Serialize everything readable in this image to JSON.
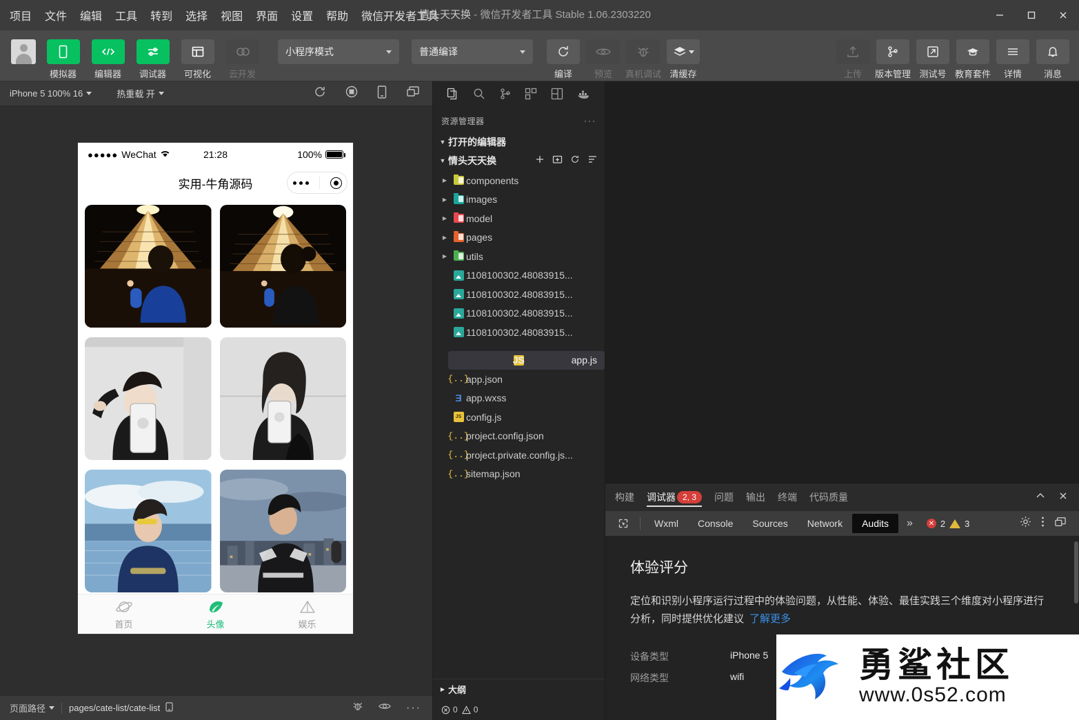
{
  "window": {
    "title_project": "情头天天换",
    "title_sep": " - ",
    "title_app": "微信开发者工具 Stable 1.06.2303220",
    "minimize": "minimize-icon",
    "maximize": "maximize-icon",
    "close": "close-icon"
  },
  "menu": {
    "items": [
      {
        "label": "项目"
      },
      {
        "label": "文件"
      },
      {
        "label": "编辑"
      },
      {
        "label": "工具"
      },
      {
        "label": "转到"
      },
      {
        "label": "选择"
      },
      {
        "label": "视图"
      },
      {
        "label": "界面"
      },
      {
        "label": "设置"
      },
      {
        "label": "帮助"
      },
      {
        "label": "微信开发者工具"
      }
    ]
  },
  "toolbar": {
    "panel_buttons": [
      {
        "label": "模拟器",
        "icon": "phone-icon",
        "state": "active"
      },
      {
        "label": "编辑器",
        "icon": "code-icon",
        "state": "active"
      },
      {
        "label": "调试器",
        "icon": "debug-icon",
        "state": "active"
      },
      {
        "label": "可视化",
        "icon": "layout-icon",
        "state": "normal"
      },
      {
        "label": "云开发",
        "icon": "cloud-icon",
        "state": "disabled"
      }
    ],
    "mode_select": {
      "value": "小程序模式"
    },
    "compile_select": {
      "value": "普通编译"
    },
    "action_buttons": [
      {
        "label": "编译",
        "icon": "refresh-icon",
        "state": "normal"
      },
      {
        "label": "预览",
        "icon": "eye-icon",
        "state": "disabled"
      },
      {
        "label": "真机调试",
        "icon": "bug-icon",
        "state": "disabled"
      },
      {
        "label": "清缓存",
        "icon": "layers-icon",
        "state": "normal"
      }
    ],
    "right_buttons": [
      {
        "label": "上传",
        "icon": "upload-icon",
        "state": "disabled"
      },
      {
        "label": "版本管理",
        "icon": "git-branch-icon",
        "state": "normal"
      },
      {
        "label": "测试号",
        "icon": "external-link-icon",
        "state": "normal"
      },
      {
        "label": "教育套件",
        "icon": "graduation-cap-icon",
        "state": "normal"
      },
      {
        "label": "详情",
        "icon": "menu-lines-icon",
        "state": "normal"
      },
      {
        "label": "消息",
        "icon": "bell-icon",
        "state": "normal"
      }
    ]
  },
  "simulator": {
    "device_select": "iPhone 5 100% 16",
    "hotreload_select": "热重载 开",
    "toolbar_icons": [
      "rotate-icon",
      "record-icon",
      "device-icon",
      "windows-icon"
    ],
    "phone": {
      "status": {
        "carrier": "WeChat",
        "signal_dots": "●●●●●",
        "wifi": "wifi-icon",
        "time": "21:28",
        "battery_percent": "100%"
      },
      "nav_title": "实用-牛角源码",
      "capsule": {
        "more": "more-dots-icon",
        "target": "target-circle-icon"
      },
      "tabbar": [
        {
          "label": "首页",
          "icon": "planet-icon",
          "active": false
        },
        {
          "label": "头像",
          "icon": "avatar-leaf-icon",
          "active": true
        },
        {
          "label": "娱乐",
          "icon": "tent-icon",
          "active": false
        }
      ]
    },
    "footer": {
      "page_path_label": "页面路径",
      "page_path_value": "pages/cate-list/cate-list",
      "copy_icon": "copy-icon",
      "icons": [
        "bug-icon",
        "eye-icon",
        "more-icon"
      ]
    }
  },
  "explorer": {
    "activity_icons": [
      "files-icon",
      "search-icon",
      "source-control-icon",
      "extensions-icon",
      "layout-icon",
      "docker-icon"
    ],
    "header": "资源管理器",
    "header_more": "more-icon",
    "open_editors": "打开的编辑器",
    "project_name": "情头天天换",
    "project_actions": [
      "new-file-icon",
      "new-folder-icon",
      "refresh-icon",
      "collapse-all-icon"
    ],
    "tree": [
      {
        "name": "components",
        "type": "folder",
        "color": "#c9c93c"
      },
      {
        "name": "images",
        "type": "folder",
        "color": "#1aa79a"
      },
      {
        "name": "model",
        "type": "folder",
        "color": "#e8484d"
      },
      {
        "name": "pages",
        "type": "folder",
        "color": "#e8622c"
      },
      {
        "name": "utils",
        "type": "folder",
        "color": "#4caf50"
      },
      {
        "name": "1108100302.48083915...",
        "type": "image"
      },
      {
        "name": "1108100302.48083915...",
        "type": "image"
      },
      {
        "name": "1108100302.48083915...",
        "type": "image"
      },
      {
        "name": "1108100302.48083915...",
        "type": "image"
      },
      {
        "name": "app.js",
        "type": "js",
        "selected": true
      },
      {
        "name": "app.json",
        "type": "json"
      },
      {
        "name": "app.wxss",
        "type": "wxss"
      },
      {
        "name": "config.js",
        "type": "js"
      },
      {
        "name": "project.config.json",
        "type": "json"
      },
      {
        "name": "project.private.config.js...",
        "type": "json"
      },
      {
        "name": "sitemap.json",
        "type": "json"
      }
    ],
    "outline": "大纲",
    "status_errors": "0",
    "status_warnings": "0"
  },
  "devtools": {
    "tabs": [
      {
        "label": "构建",
        "active": false
      },
      {
        "label": "调试器",
        "active": true,
        "badge": "2, 3"
      },
      {
        "label": "问题",
        "active": false
      },
      {
        "label": "输出",
        "active": false
      },
      {
        "label": "终端",
        "active": false
      },
      {
        "label": "代码质量",
        "active": false
      }
    ],
    "collapse_icon": "chevron-up-icon",
    "close_icon": "close-icon",
    "sub_tabs": [
      {
        "label": "Wxml",
        "active": false
      },
      {
        "label": "Console",
        "active": false
      },
      {
        "label": "Sources",
        "active": false
      },
      {
        "label": "Network",
        "active": false
      },
      {
        "label": "Audits",
        "active": true
      }
    ],
    "overflow": "»",
    "error_count": "2",
    "warning_count": "3",
    "right_icons": [
      "gear-icon",
      "kebab-menu-icon",
      "dock-icon"
    ],
    "audits": {
      "title": "体验评分",
      "description": "定位和识别小程序运行过程中的体验问题，从性能、体验、最佳实践三个维度对小程序进行分析，同时提供优化建议",
      "link": "了解更多",
      "details": [
        {
          "key": "设备类型",
          "value": "iPhone 5"
        },
        {
          "key": "网络类型",
          "value": "wifi"
        }
      ]
    }
  },
  "watermark": {
    "text_cn": "勇鲨社区",
    "url": "www.0s52.com",
    "logo": "shark-logo-icon"
  },
  "colors": {
    "accent_green": "#07c160",
    "error_red": "#d43f3a",
    "warning_yellow": "#e2b93d",
    "link_blue": "#3a8ee6"
  }
}
